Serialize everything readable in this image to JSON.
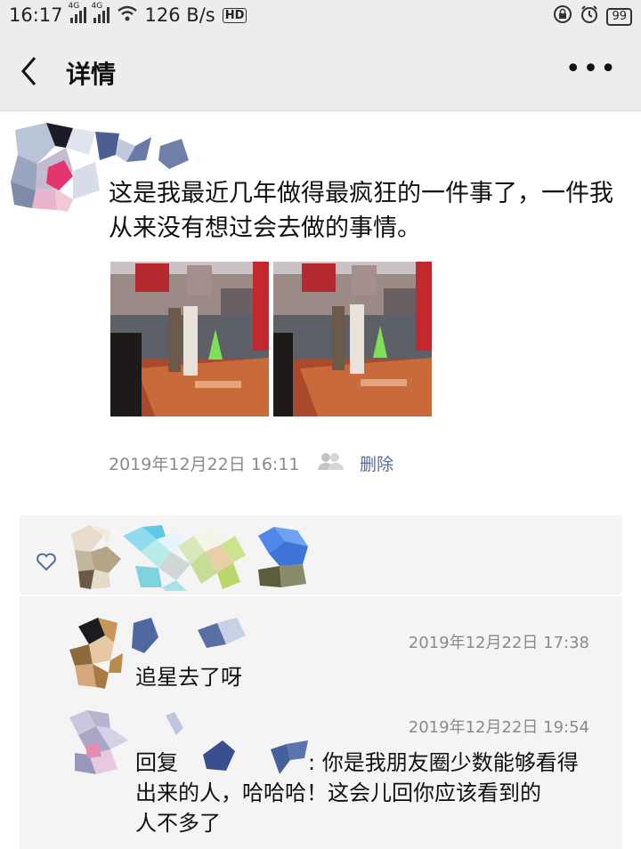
{
  "status_bar": {
    "time": "16:17",
    "network_1": "4G",
    "network_2": "4G",
    "speed": "126 B/s",
    "hd_label": "HD",
    "battery": "99"
  },
  "nav": {
    "title": "详情",
    "back_icon": "chevron-left-icon",
    "more_icon": "more-dots-icon",
    "more_label": "•••"
  },
  "post": {
    "text": "这是我最近几年做得最疯狂的一件事了，一件我从来没有想过会去做的事情。",
    "timestamp": "2019年12月22日 16:11",
    "delete_label": "删除",
    "photo_count": 2
  },
  "comments": [
    {
      "time": "2019年12月22日 17:38",
      "text": "追星去了呀"
    },
    {
      "time": "2019年12月22日 19:54",
      "reply_prefix": "回复",
      "text_after": ": 你是我朋友圈少数能够看得",
      "text_line2": "出来的人，哈哈哈！这会儿回你应该看到的",
      "text_line3": "人不多了"
    }
  ],
  "colors": {
    "link": "#576b95",
    "meta": "#8a8a8a",
    "bar_bg": "#ededed",
    "panel_bg": "#f4f4f4"
  }
}
